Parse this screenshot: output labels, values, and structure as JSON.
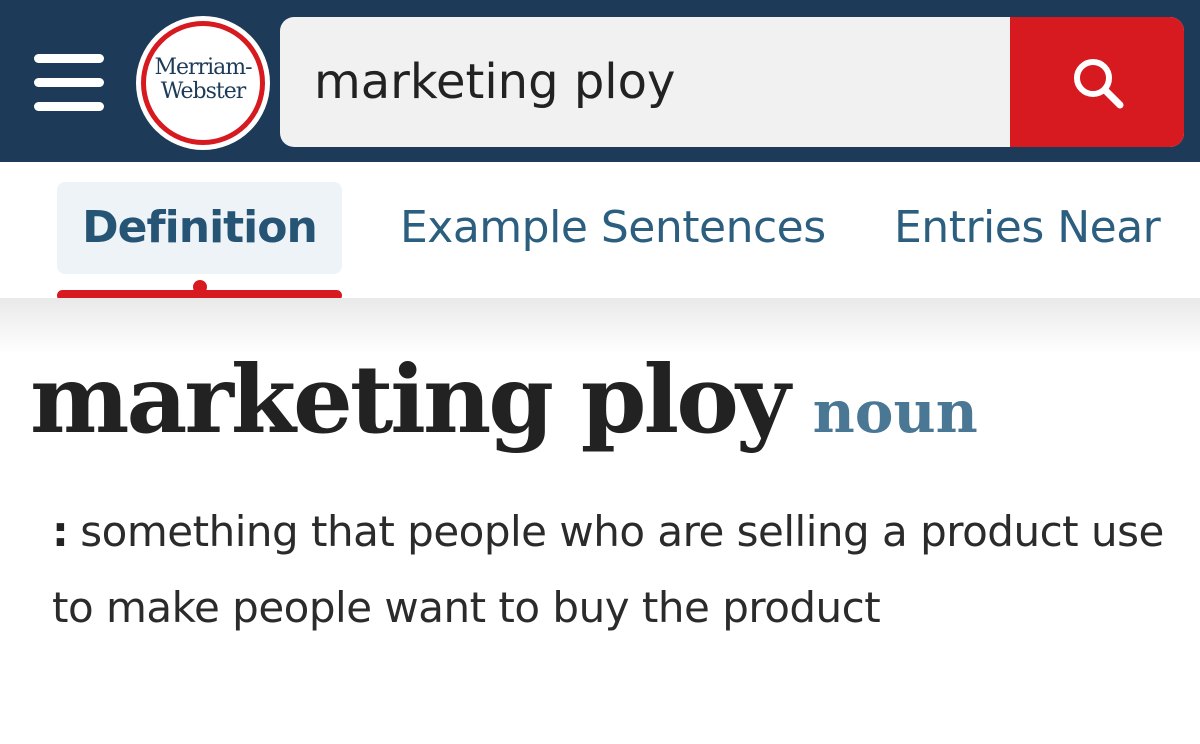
{
  "colors": {
    "header_bg": "#1d3b58",
    "brand_red": "#d71920",
    "tab_text": "#2b5e7f",
    "pos_text": "#4a7894"
  },
  "header": {
    "menu_icon": "hamburger-menu-icon",
    "logo": {
      "line1": "Merriam-",
      "line2": "Webster"
    },
    "search": {
      "value": "marketing ploy",
      "button_icon": "search-icon"
    }
  },
  "tabs": [
    {
      "label": "Definition",
      "active": true
    },
    {
      "label": "Example Sentences",
      "active": false
    },
    {
      "label": "Entries Near",
      "active": false
    }
  ],
  "entry": {
    "headword": "marketing ploy",
    "part_of_speech": "noun",
    "definition_colon": ":",
    "definition": "something that people who are selling a product use to make people want to buy the product"
  }
}
